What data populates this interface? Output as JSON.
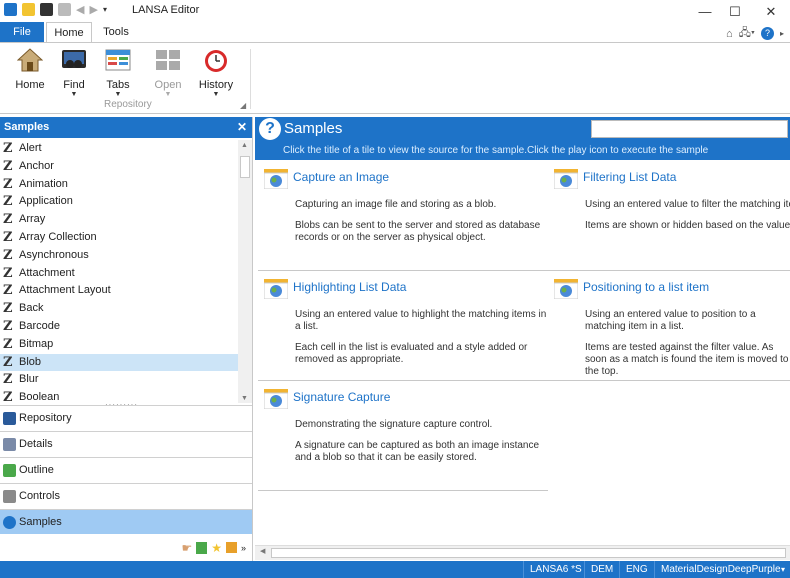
{
  "window": {
    "title": "LANSA Editor",
    "controls": {
      "minimize": "—",
      "maximize": "☐",
      "close": "✕"
    }
  },
  "ribbon": {
    "tabs": [
      {
        "label": "File"
      },
      {
        "label": "Home"
      },
      {
        "label": "Tools"
      }
    ],
    "buttons": [
      {
        "label": "Home"
      },
      {
        "label": "Find"
      },
      {
        "label": "Tabs"
      },
      {
        "label": "Open"
      },
      {
        "label": "History"
      }
    ],
    "group_label": "Repository"
  },
  "left_panel": {
    "title": "Samples",
    "close": "✕",
    "items": [
      {
        "label": "Alert"
      },
      {
        "label": "Anchor"
      },
      {
        "label": "Animation"
      },
      {
        "label": "Application"
      },
      {
        "label": "Array"
      },
      {
        "label": "Array Collection"
      },
      {
        "label": "Asynchronous"
      },
      {
        "label": "Attachment"
      },
      {
        "label": "Attachment Layout"
      },
      {
        "label": "Back"
      },
      {
        "label": "Barcode"
      },
      {
        "label": "Bitmap"
      },
      {
        "label": "Blob"
      },
      {
        "label": "Blur"
      },
      {
        "label": "Boolean"
      }
    ],
    "selected": "Blob",
    "nav": [
      {
        "label": "Repository"
      },
      {
        "label": "Details"
      },
      {
        "label": "Outline"
      },
      {
        "label": "Controls"
      },
      {
        "label": "Samples"
      }
    ]
  },
  "main": {
    "title": "Samples",
    "search": "",
    "instruction_left": "Click the title of a tile to view the source for the sample.",
    "instruction_right": "Click the play icon to execute the sample",
    "tiles": [
      {
        "title": "Capture an Image",
        "desc1": "Capturing an image file and storing as a blob.",
        "desc2": "Blobs can be sent to the server and stored as database records or on the server as physical object."
      },
      {
        "title": "Filtering List Data",
        "desc1": "Using an entered value to filter the matching items in a list.",
        "desc2": "Items are shown or hidden based on the value entered."
      },
      {
        "title": "Highlighting List Data",
        "desc1": "Using an entered value to highlight the matching items in a list.",
        "desc2": "Each cell in the list is evaluated and a style added or removed as appropriate."
      },
      {
        "title": "Positioning to a list item",
        "desc1": "Using an entered value to position to a matching item in a list.",
        "desc2": "Items are tested against the filter value. As soon as a match is found the item is moved to the top."
      },
      {
        "title": "Signature Capture",
        "desc1": "Demonstrating the signature capture control.",
        "desc2": "A signature can be captured as both an image instance and a blob so that it can be easily stored."
      }
    ]
  },
  "status": {
    "items": [
      "LANSA6 *S",
      "DEM",
      "ENG",
      "MaterialDesignDeepPurple"
    ]
  }
}
